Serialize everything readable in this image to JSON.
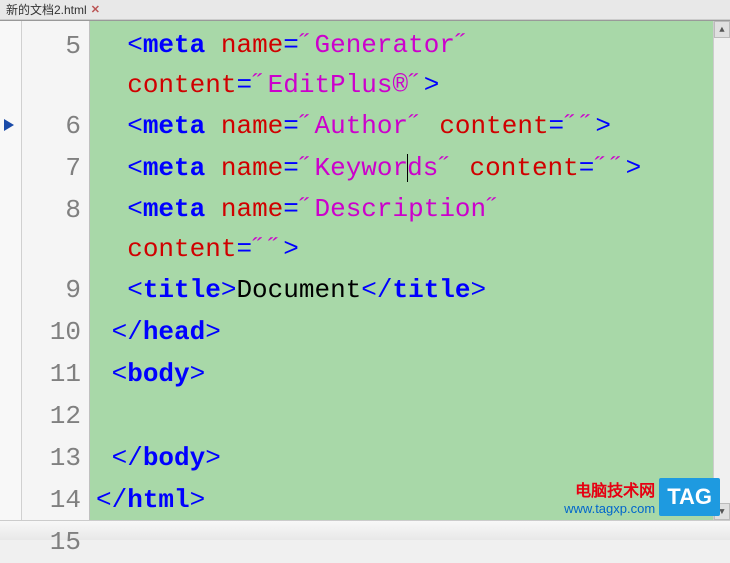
{
  "tab": {
    "label": "新的文档2.html"
  },
  "gutter": [
    "5",
    "6",
    "7",
    "8",
    "9",
    "10",
    "11",
    "12",
    "13",
    "14",
    "15"
  ],
  "code": {
    "l5": {
      "ind": "  ",
      "o": "<",
      "tag": "meta",
      "sp": " ",
      "a1": "name",
      "eq": "=",
      "v1": "˝Generator˝",
      "nl": "",
      "ind2": "  ",
      "a2": "content",
      "eq2": "=",
      "v2": "˝EditPlus®˝",
      "c": ">"
    },
    "l6": {
      "ind": "  ",
      "o": "<",
      "tag": "meta",
      "sp": " ",
      "a1": "name",
      "eq": "=",
      "v1": "˝Author˝",
      "sp2": " ",
      "a2": "content",
      "eq2": "=",
      "v2": "˝˝",
      "c": ">"
    },
    "l7": {
      "ind": "  ",
      "o": "<",
      "tag": "meta",
      "sp": " ",
      "a1": "name",
      "eq": "=",
      "v1a": "˝Keywor",
      "v1b": "ds˝",
      "sp2": " ",
      "a2": "content",
      "eq2": "=",
      "v2": "˝˝",
      "c": ">"
    },
    "l8": {
      "ind": "  ",
      "o": "<",
      "tag": "meta",
      "sp": " ",
      "a1": "name",
      "eq": "=",
      "v1": "˝Description˝",
      "nl": "",
      "ind2": "  ",
      "a2": "content",
      "eq2": "=",
      "v2": "˝˝",
      "c": ">"
    },
    "l9": {
      "ind": "  ",
      "o": "<",
      "tag": "title",
      "c": ">",
      "txt": "Document",
      "o2": "</",
      "tag2": "title",
      "c2": ">"
    },
    "l10": {
      "ind": " ",
      "o": "</",
      "tag": "head",
      "c": ">"
    },
    "l11": {
      "ind": " ",
      "o": "<",
      "tag": "body",
      "c": ">"
    },
    "l12": {
      "ind": "  "
    },
    "l13": {
      "ind": " ",
      "o": "</",
      "tag": "body",
      "c": ">"
    },
    "l14": {
      "o": "</",
      "tag": "html",
      "c": ">"
    },
    "l15": {}
  },
  "watermark": {
    "line1": "电脑技术网",
    "line2": "www.tagxp.com",
    "tag": "TAG"
  }
}
